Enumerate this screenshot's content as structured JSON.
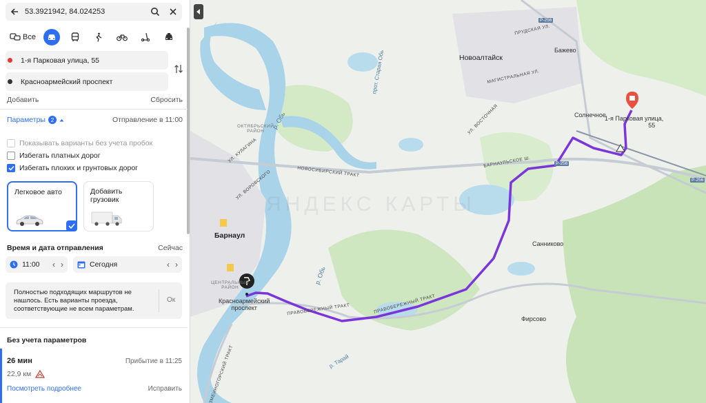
{
  "search": {
    "coords": "53.3921942, 84.024253"
  },
  "modes": {
    "all_label": "Все"
  },
  "route_points": {
    "from": "1-я Парковая улица, 55",
    "to": "Красноармейский проспект",
    "from_color": "#e53935",
    "to_color": "#333333"
  },
  "actions": {
    "add": "Добавить",
    "reset": "Сбросить"
  },
  "params": {
    "label": "Параметры",
    "count": "2",
    "departure": "Отправление в 11:00"
  },
  "options": [
    {
      "label": "Показывать варианты без учета пробок",
      "checked": false,
      "disabled": true
    },
    {
      "label": "Избегать платных дорог",
      "checked": false,
      "disabled": false
    },
    {
      "label": "Избегать плохих и грунтовых дорог",
      "checked": true,
      "disabled": false
    }
  ],
  "vehicles": {
    "car": "Легковое авто",
    "truck": "Добавить грузовик"
  },
  "datetime": {
    "title": "Время и дата отправления",
    "now": "Сейчас",
    "time": "11:00",
    "date": "Сегодня"
  },
  "warning": {
    "message": "Полностью подходящих маршрутов не нашлось. Есть варианты проезда, соответствующие не всем параметрам.",
    "ok": "Ок"
  },
  "no_params_title": "Без учета параметров",
  "route": {
    "duration": "26 мин",
    "arrival": "Прибытие в 11:25",
    "distance": "22,9 км",
    "details": "Посмотреть подробнее",
    "fix": "Исправить"
  },
  "map": {
    "labels": {
      "novoaltaisk": "Новоалтайск",
      "barnaul": "Барнаул",
      "bazhevo": "Бажево",
      "solnechnoe": "Солнечное",
      "sannikovo": "Санниково",
      "firsovo": "Фирсово",
      "dest1": "1-я Парковая улица,",
      "dest2": "55",
      "orig1": "Красноармейский",
      "orig2": "проспект",
      "oktyabrsky1": "ОКТЯБРЬСКИЙ",
      "oktyabrsky2": "РАЙОН",
      "central1": "ЦЕНТРАЛЬНЫЙ",
      "central2": "РАЙОН",
      "road_novosib": "НОВОСИБИРСКИЙ ТРАКТ",
      "road_barnaul": "БАРНАУЛЬСКОЕ Ш.",
      "road_pravober": "ПРАВОБЕРЕЖНЫЙ ТРАКТ",
      "road_pravober2": "ПРАВОБЕРЕЖНЫЙ ТРАКТ",
      "road_magistral": "МАГИСТРАЛЬНАЯ УЛ.",
      "road_prudskaya": "ПРУДСКАЯ УЛ.",
      "road_vostochnaya": "УЛ. ВОСТОЧНАЯ",
      "road_voroshilov": "УЛ. ВОРОВСКОГО",
      "road_kulagina": "УЛ. КУЛАГИНА",
      "road_zmein": "ЗМЕИНОГОРСКИЙ ТРАКТ",
      "river_ob": "р. Обь",
      "river_ob2": "р. Обь",
      "river_staraya": "прот. Старая Обь",
      "river_taray": "р. Тарай",
      "route_r256a": "Р-256",
      "route_r256b": "Р-256",
      "route_r256c": "Р-256",
      "watermark": "ЯНДЕКС КАРТЫ"
    },
    "route_color": "#7b36d9",
    "water_color": "#a9d3e8",
    "forest_color": "#c9e3b8"
  }
}
